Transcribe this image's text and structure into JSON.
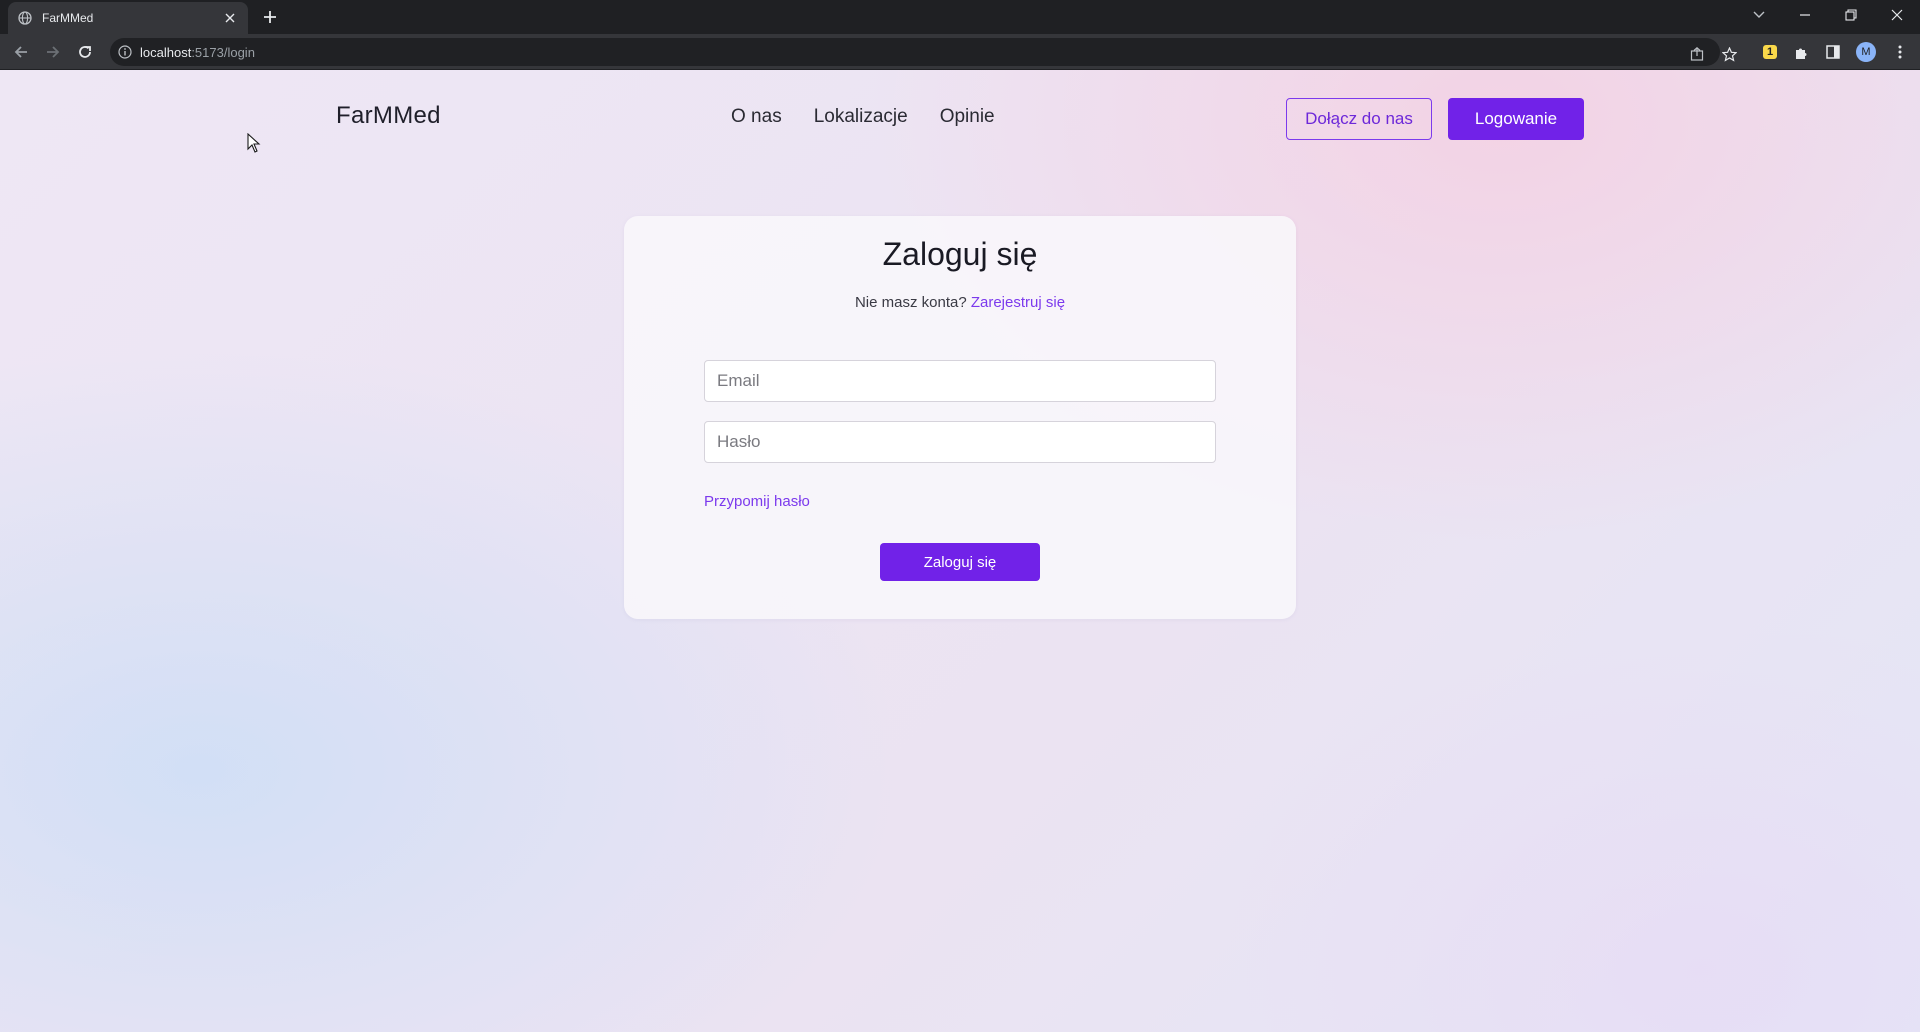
{
  "browser": {
    "tab_title": "FarMMed",
    "url_host": "localhost",
    "url_path": ":5173/login",
    "profile_initial": "M",
    "extension_badge": "1"
  },
  "site": {
    "logo": "FarMMed",
    "nav": [
      {
        "label": "O nas"
      },
      {
        "label": "Lokalizacje"
      },
      {
        "label": "Opinie"
      }
    ],
    "join_button": "Dołącz do nas",
    "login_button": "Logowanie"
  },
  "login": {
    "title": "Zaloguj się",
    "no_account_text": "Nie masz konta?",
    "register_link": "Zarejestruj się",
    "email_placeholder": "Email",
    "password_placeholder": "Hasło",
    "forgot_link": "Przypomij hasło",
    "submit": "Zaloguj się"
  },
  "colors": {
    "accent": "#7122e8",
    "accent_text": "#7c3aed",
    "chrome_dark": "#1f2023",
    "chrome_toolbar": "#35363a"
  }
}
